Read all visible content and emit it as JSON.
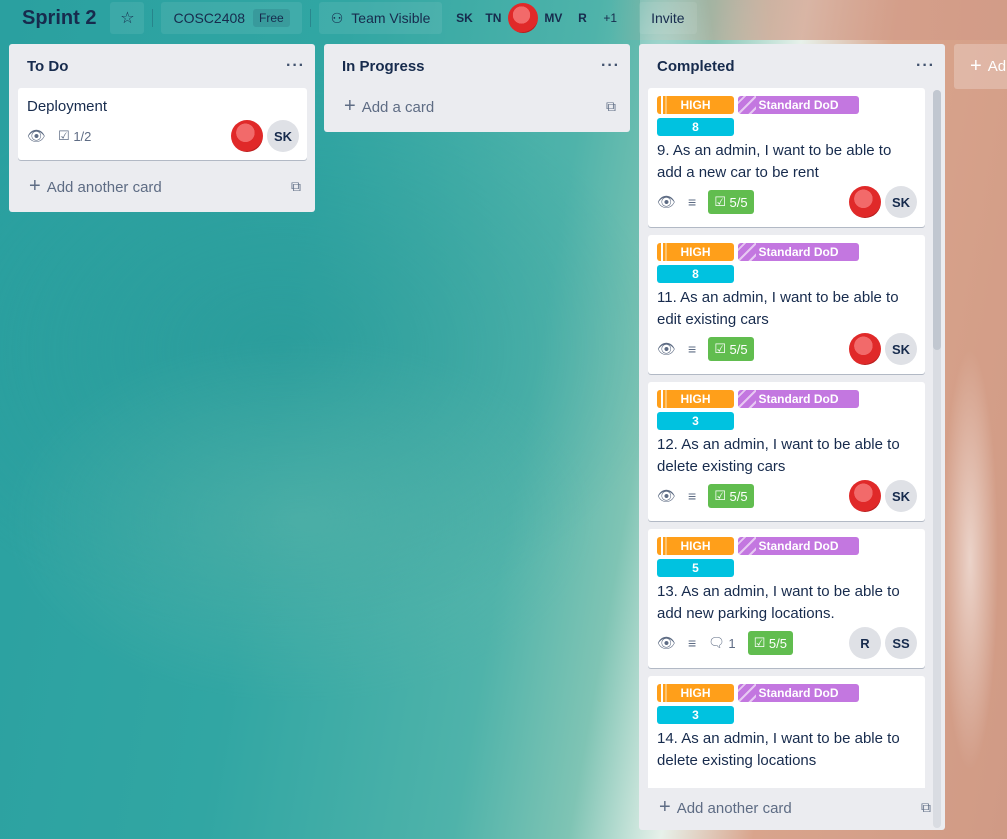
{
  "header": {
    "board_title": "Sprint 2",
    "star_icon": "star-icon",
    "workspace_name": "COSC2408",
    "workspace_badge": "Free",
    "visibility_label": "Team Visible",
    "members": [
      "SK",
      "TN",
      "MV",
      "R"
    ],
    "more_members": "+1",
    "invite_label": "Invite"
  },
  "lists": {
    "todo": {
      "title": "To Do",
      "cards": [
        {
          "title": "Deployment",
          "checklist": "1/2",
          "avatar_initials": "SK"
        }
      ],
      "add_label": "Add another card"
    },
    "in_progress": {
      "title": "In Progress",
      "add_label": "Add a card"
    },
    "completed": {
      "title": "Completed",
      "cards": [
        {
          "priority": "HIGH",
          "dod": "Standard DoD",
          "points": "8",
          "title": "9. As an admin, I want to be able to add a new car to be rent",
          "checklist": "5/5",
          "avatars": [
            "SK"
          ]
        },
        {
          "priority": "HIGH",
          "dod": "Standard DoD",
          "points": "8",
          "title": "11. As an admin, I want to be able to edit existing cars",
          "checklist": "5/5",
          "avatars": [
            "SK"
          ]
        },
        {
          "priority": "HIGH",
          "dod": "Standard DoD",
          "points": "3",
          "title": "12. As an admin, I want to be able to delete existing cars",
          "checklist": "5/5",
          "avatars": [
            "SK"
          ]
        },
        {
          "priority": "HIGH",
          "dod": "Standard DoD",
          "points": "5",
          "title": "13. As an admin, I want to be able to add new parking locations.",
          "comments": "1",
          "checklist": "5/5",
          "avatars": [
            "R",
            "SS"
          ]
        },
        {
          "priority": "HIGH",
          "dod": "Standard DoD",
          "points": "3",
          "title": "14. As an admin, I want to be able to delete existing locations"
        }
      ],
      "add_label": "Add another card"
    }
  },
  "add_list_label": "Ad",
  "colors": {
    "label_high": "#ff9f1a",
    "label_dod": "#c377e0",
    "label_points": "#00c2e0",
    "checklist_complete": "#61bd4f"
  }
}
